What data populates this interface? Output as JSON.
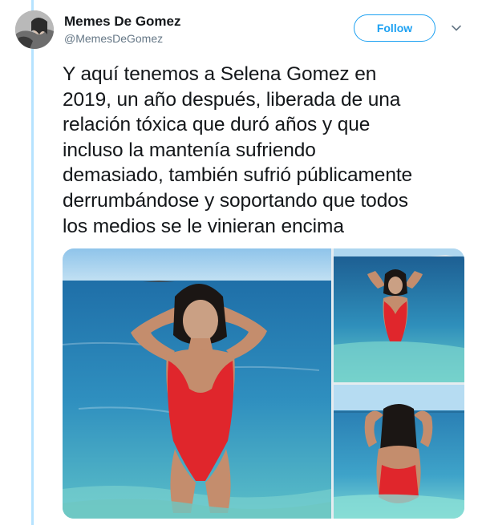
{
  "tweet": {
    "author": {
      "display_name": "Memes De Gomez",
      "handle": "@MemesDeGomez",
      "avatar_icon": "profile-avatar"
    },
    "follow_label": "Follow",
    "more_icon": "chevron-down-icon",
    "text_lines": [
      "Y aquí tenemos a Selena Gomez en",
      "2019, un año después, liberada de una",
      "relación tóxica que duró años y que",
      "incluso la mantenía sufriendo",
      "demasiado, también sufrió públicamente",
      "derrumbándose y soportando que todos",
      "los medios se le vinieran encima"
    ],
    "media_count": 3
  },
  "colors": {
    "accent": "#1da1f2",
    "thread_line": "#b6e3ff",
    "text": "#14171a",
    "secondary_text": "#657786",
    "swimsuit_red": "#e0262c",
    "sea": "#2f86b5",
    "sky": "#a9d3ee"
  }
}
